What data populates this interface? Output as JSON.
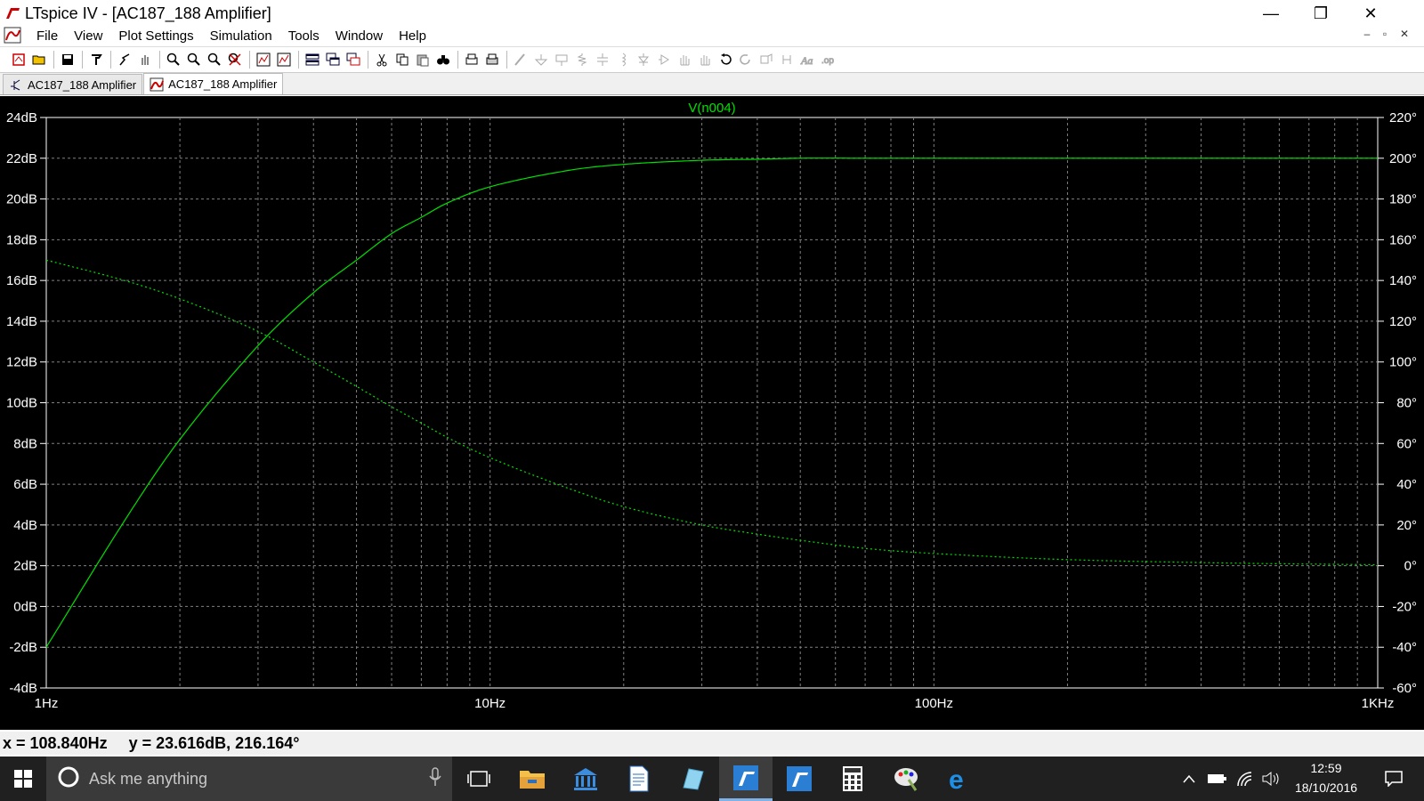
{
  "window": {
    "title": "LTspice IV - [AC187_188 Amplifier]",
    "controls": {
      "minimize": "—",
      "restore": "❐",
      "close": "✕"
    }
  },
  "menu": {
    "items": [
      "File",
      "View",
      "Plot Settings",
      "Simulation",
      "Tools",
      "Window",
      "Help"
    ],
    "mdi_controls": {
      "minimize": "–",
      "restore": "▫",
      "close": "✕"
    }
  },
  "toolbar": {
    "icons": [
      "new-schematic-icon",
      "open-icon",
      "save-icon",
      "control-panel-icon",
      "run-icon",
      "halt-icon",
      "zoom-in-icon",
      "zoom-full-icon",
      "zoom-out-icon",
      "zoom-cancel-icon",
      "autorange-icon",
      "zoom-fit-icon",
      "tile-horizontal-icon",
      "cascade-icon",
      "tile-vertical-icon",
      "cut-icon",
      "copy-icon",
      "paste-icon",
      "find-icon",
      "print-preview-icon",
      "print-icon",
      "wire-icon",
      "ground-icon",
      "label-icon",
      "resistor-icon",
      "capacitor-icon",
      "inductor-icon",
      "diode-icon",
      "component-icon",
      "move-icon",
      "drag-icon",
      "undo-icon",
      "redo-icon",
      "rotate-icon",
      "mirror-icon",
      "text-icon",
      "spice-directive-icon"
    ]
  },
  "tabs": [
    {
      "label": "AC187_188 Amplifier",
      "icon": "schematic-icon",
      "active": false
    },
    {
      "label": "AC187_188 Amplifier",
      "icon": "waveform-icon",
      "active": true
    }
  ],
  "plot": {
    "trace_label": "V(n004)",
    "status": {
      "x": "x = 108.840Hz",
      "y": "y = 23.616dB, 216.164°"
    }
  },
  "chart_data": {
    "type": "line",
    "title": "V(n004)",
    "x_scale": "log",
    "xlim": [
      1,
      1000
    ],
    "x_ticks": [
      "1Hz",
      "10Hz",
      "100Hz",
      "1KHz"
    ],
    "ylim_left": [
      -4,
      24
    ],
    "y_ticks_left": [
      "24dB",
      "22dB",
      "20dB",
      "18dB",
      "16dB",
      "14dB",
      "12dB",
      "10dB",
      "8dB",
      "6dB",
      "4dB",
      "2dB",
      "0dB",
      "-2dB",
      "-4dB"
    ],
    "ylim_right": [
      -60,
      220
    ],
    "y_ticks_right": [
      "220°",
      "200°",
      "180°",
      "160°",
      "140°",
      "120°",
      "100°",
      "80°",
      "60°",
      "40°",
      "20°",
      "0°",
      "-20°",
      "-40°",
      "-60°"
    ],
    "grid": true,
    "trace_color": "#00e000",
    "series": [
      {
        "name": "V(n004)",
        "axis": "left",
        "style": "solid",
        "x": [
          1,
          1.5,
          2,
          3,
          4,
          5,
          6,
          7,
          8,
          10,
          15,
          20,
          30,
          40,
          50,
          70,
          100,
          200,
          500,
          1000
        ],
        "values": [
          -2.0,
          4.2,
          8.2,
          12.8,
          15.4,
          17.0,
          18.3,
          19.1,
          19.8,
          20.6,
          21.4,
          21.7,
          21.9,
          21.95,
          22.0,
          22.0,
          22.0,
          22.0,
          22.0,
          22.0
        ]
      },
      {
        "name": "phase",
        "axis": "right",
        "style": "dashed",
        "x": [
          1,
          1.5,
          2,
          3,
          4,
          5,
          6,
          7,
          8,
          10,
          15,
          20,
          30,
          40,
          50,
          70,
          100,
          200,
          500,
          1000
        ],
        "values": [
          150,
          140,
          131,
          115,
          100,
          88,
          78,
          70,
          63,
          53,
          38,
          29,
          20,
          15.5,
          12.5,
          8.5,
          6,
          3,
          1.2,
          0.5
        ]
      }
    ]
  },
  "taskbar": {
    "search_placeholder": "Ask me anything",
    "apps": [
      "task-view-icon",
      "file-explorer-icon",
      "bank-icon",
      "document-icon",
      "notepad-icon",
      "ltspice-iv-icon",
      "ltspice-xvii-icon",
      "calculator-icon",
      "paint-icon",
      "edge-icon"
    ],
    "clock_time": "12:59",
    "clock_date": "18/10/2016"
  }
}
